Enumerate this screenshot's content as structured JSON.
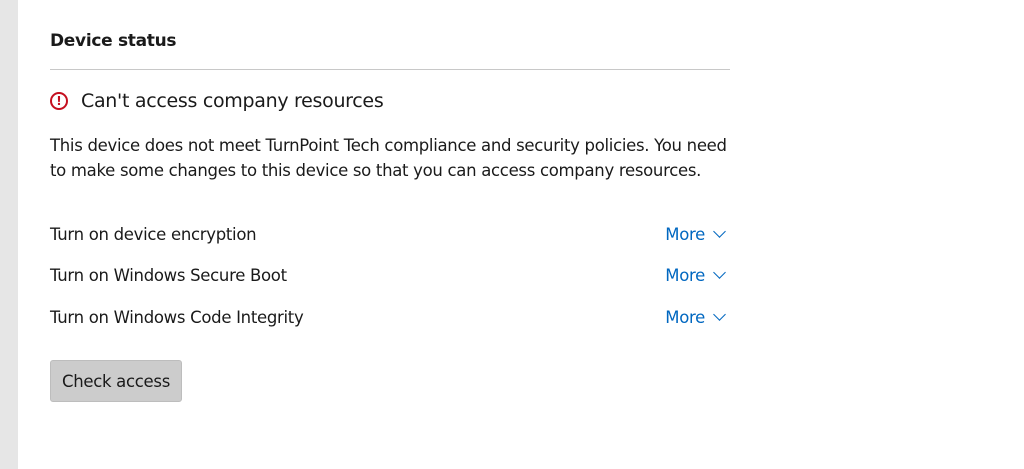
{
  "section_title": "Device status",
  "status": {
    "icon": "alert-circle-icon",
    "text": "Can't access company resources",
    "color": "#c50f1f"
  },
  "description": "This device does not meet TurnPoint Tech compliance and security policies. You need to make some changes to this device so that you can access company resources.",
  "requirements": [
    {
      "label": "Turn on device encryption",
      "more": "More"
    },
    {
      "label": "Turn on Windows Secure Boot",
      "more": "More"
    },
    {
      "label": "Turn on Windows Code Integrity",
      "more": "More"
    }
  ],
  "check_access_label": "Check access",
  "accent": "#0067c0"
}
